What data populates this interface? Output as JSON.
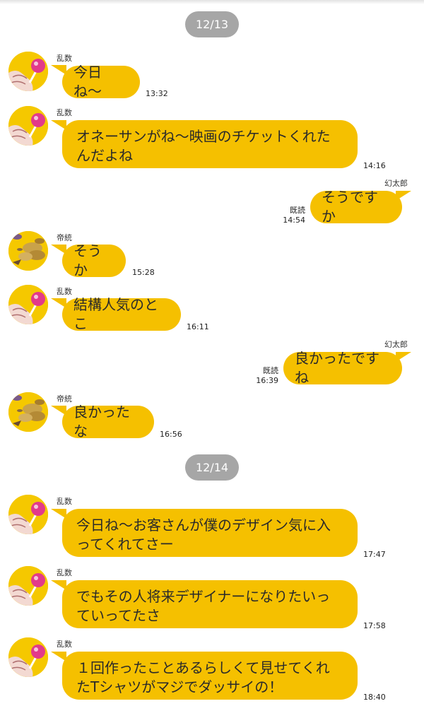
{
  "dates": [
    "12/13",
    "12/14"
  ],
  "names": {
    "ranpo": "乱数",
    "dice": "帝統",
    "gentaro": "幻太郎"
  },
  "read_label": "既読",
  "messages": [
    {
      "text": "今日ね〜",
      "time": "13:32"
    },
    {
      "text": "オネーサンがね〜映画のチケットくれたんだよね",
      "time": "14:16"
    },
    {
      "text": "そうですか",
      "time": "14:54"
    },
    {
      "text": "そうか",
      "time": "15:28"
    },
    {
      "text": "結構人気のとこ",
      "time": "16:11"
    },
    {
      "text": "良かったですね",
      "time": "16:39"
    },
    {
      "text": "良かったな",
      "time": "16:56"
    },
    {
      "text": "今日ね〜お客さんが僕のデザイン気に入ってくれてさー",
      "time": "17:47"
    },
    {
      "text": "でもその人将来デザイナーになりたいっていってたさ",
      "time": "17:58"
    },
    {
      "text": "１回作ったことあるらしくて見せてくれたTシャツがマジでダッサイの！",
      "time": "18:40"
    }
  ],
  "colors": {
    "bubble": "#f5c000",
    "date_pill": "#a6a6a6",
    "background": "#ffffff"
  },
  "icons": {
    "ranpo": "lollipop-avatar-icon",
    "dice": "coins-avatar-icon"
  }
}
